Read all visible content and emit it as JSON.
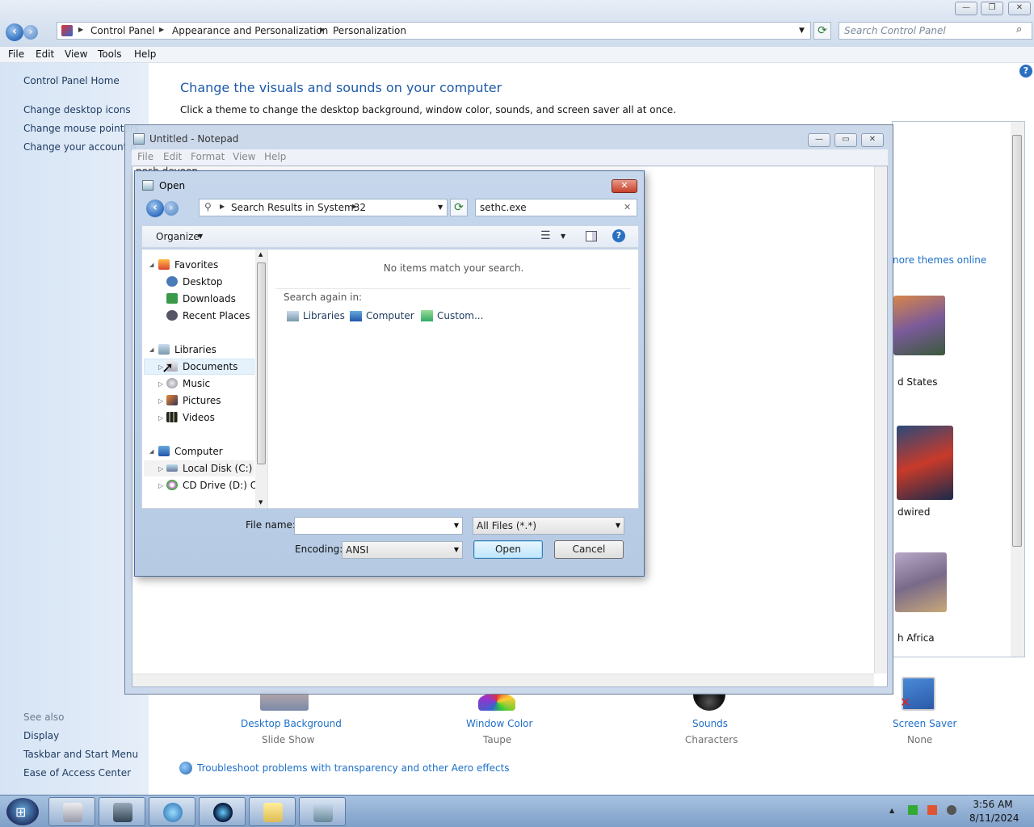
{
  "control_panel": {
    "breadcrumb": [
      "Control Panel",
      "Appearance and Personalization",
      "Personalization"
    ],
    "search_placeholder": "Search Control Panel",
    "menu": [
      "File",
      "Edit",
      "View",
      "Tools",
      "Help"
    ],
    "sidebar": {
      "home": "Control Panel Home",
      "links": [
        "Change desktop icons",
        "Change mouse pointers",
        "Change your account p"
      ],
      "see_also_title": "See also",
      "see_also": [
        "Display",
        "Taskbar and Start Menu",
        "Ease of Access Center"
      ]
    },
    "heading": "Change the visuals and sounds on your computer",
    "description": "Click a theme to change the desktop background, window color, sounds, and screen saver all at once.",
    "themes_online_link": "nore themes online",
    "theme_captions": [
      "d States",
      "dwired",
      "h Africa"
    ],
    "settings": [
      {
        "label": "Desktop Background",
        "value": "Slide Show"
      },
      {
        "label": "Window Color",
        "value": "Taupe"
      },
      {
        "label": "Sounds",
        "value": "Characters"
      },
      {
        "label": "Screen Saver",
        "value": "None"
      }
    ],
    "troubleshoot_link": "Troubleshoot problems with transparency and other Aero effects"
  },
  "notepad": {
    "title": "Untitled - Notepad",
    "menu": [
      "File",
      "Edit",
      "Format",
      "View",
      "Help"
    ],
    "text": "nosh devoon"
  },
  "open_dialog": {
    "title": "Open",
    "address": "Search Results in System32",
    "search_value": "sethc.exe",
    "organize_label": "Organize",
    "nav": {
      "favorites": "Favorites",
      "favorites_items": [
        "Desktop",
        "Downloads",
        "Recent Places"
      ],
      "libraries": "Libraries",
      "libraries_items": [
        "Documents",
        "Music",
        "Pictures",
        "Videos"
      ],
      "computer": "Computer",
      "computer_items": [
        "Local Disk (C:)",
        "CD Drive (D:) OFF"
      ]
    },
    "empty_message": "No items match your search.",
    "search_again_label": "Search again in:",
    "search_again_options": [
      "Libraries",
      "Computer",
      "Custom..."
    ],
    "file_name_label": "File name:",
    "file_name_value": "",
    "file_type_value": "All Files  (*.*)",
    "encoding_label": "Encoding:",
    "encoding_value": "ANSI",
    "open_label": "Open",
    "cancel_label": "Cancel"
  },
  "taskbar": {
    "time": "3:56 AM",
    "date": "8/11/2024"
  }
}
